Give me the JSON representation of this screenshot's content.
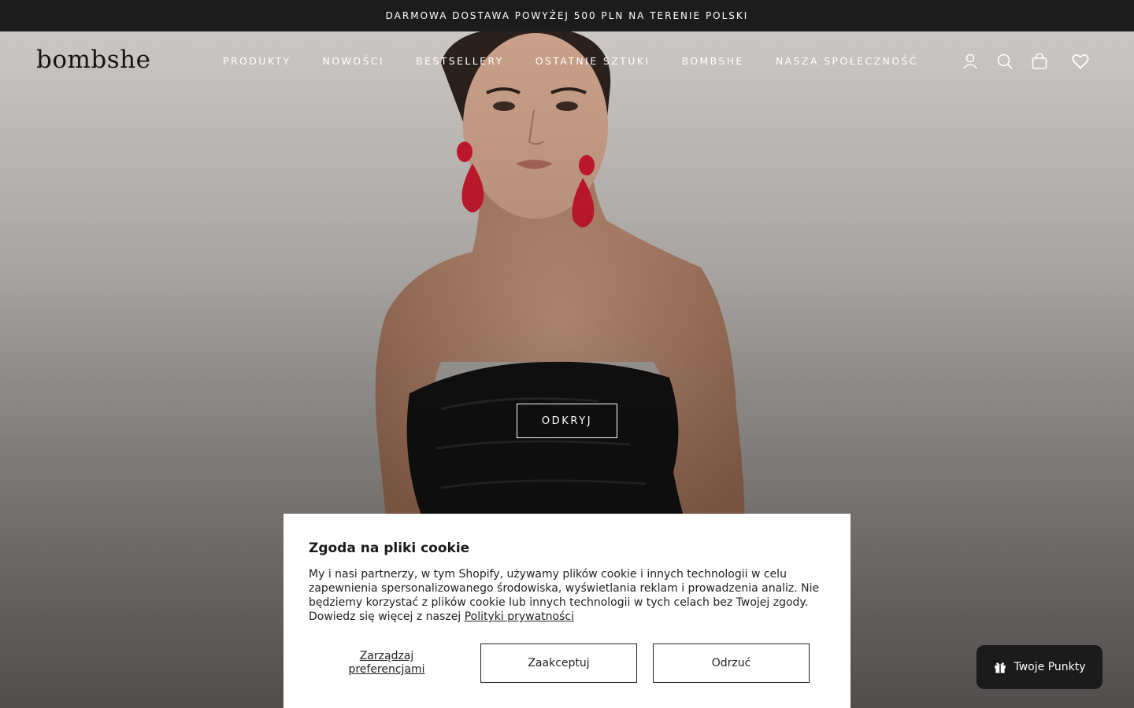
{
  "announcement": {
    "text": "DARMOWA DOSTAWA POWYŻEJ 500 PLN NA TERENIE POLSKI"
  },
  "header": {
    "logo": "bombshe",
    "nav": [
      "PRODUKTY",
      "NOWOŚCI",
      "BESTSELLERY",
      "OSTATNIE SZTUKI",
      "BOMBSHE",
      "NASZA SPOŁECZNOŚĆ"
    ],
    "icons": [
      "account-icon",
      "search-icon",
      "cart-bag-icon",
      "wishlist-heart-icon"
    ]
  },
  "hero": {
    "cta_label": "ODKRYJ"
  },
  "cookie_banner": {
    "title": "Zgoda na pliki cookie",
    "body": "My i nasi partnerzy, w tym Shopify, używamy plików cookie i innych technologii w celu zapewnienia spersonalizowanego środowiska, wyświetlania reklam i prowadzenia analiz. Nie będziemy korzystać z plików cookie lub innych technologii w tych celach bez Twojej zgody. Dowiedz się więcej z naszej",
    "link_text": "Polityki prywatności",
    "manage_line1": "Zarządzaj",
    "manage_line2": "preferencjami",
    "accept_label": "Zaakceptuj",
    "reject_label": "Odrzuć"
  },
  "rewards": {
    "label": "Twoje Punkty",
    "icon": "gift-icon"
  },
  "colors": {
    "announcement_bg": "#1c1c1c",
    "modal_bg": "#ffffff",
    "rewards_bg": "#1b1b1b",
    "earring": "#c8192e",
    "dress": "#121212"
  }
}
